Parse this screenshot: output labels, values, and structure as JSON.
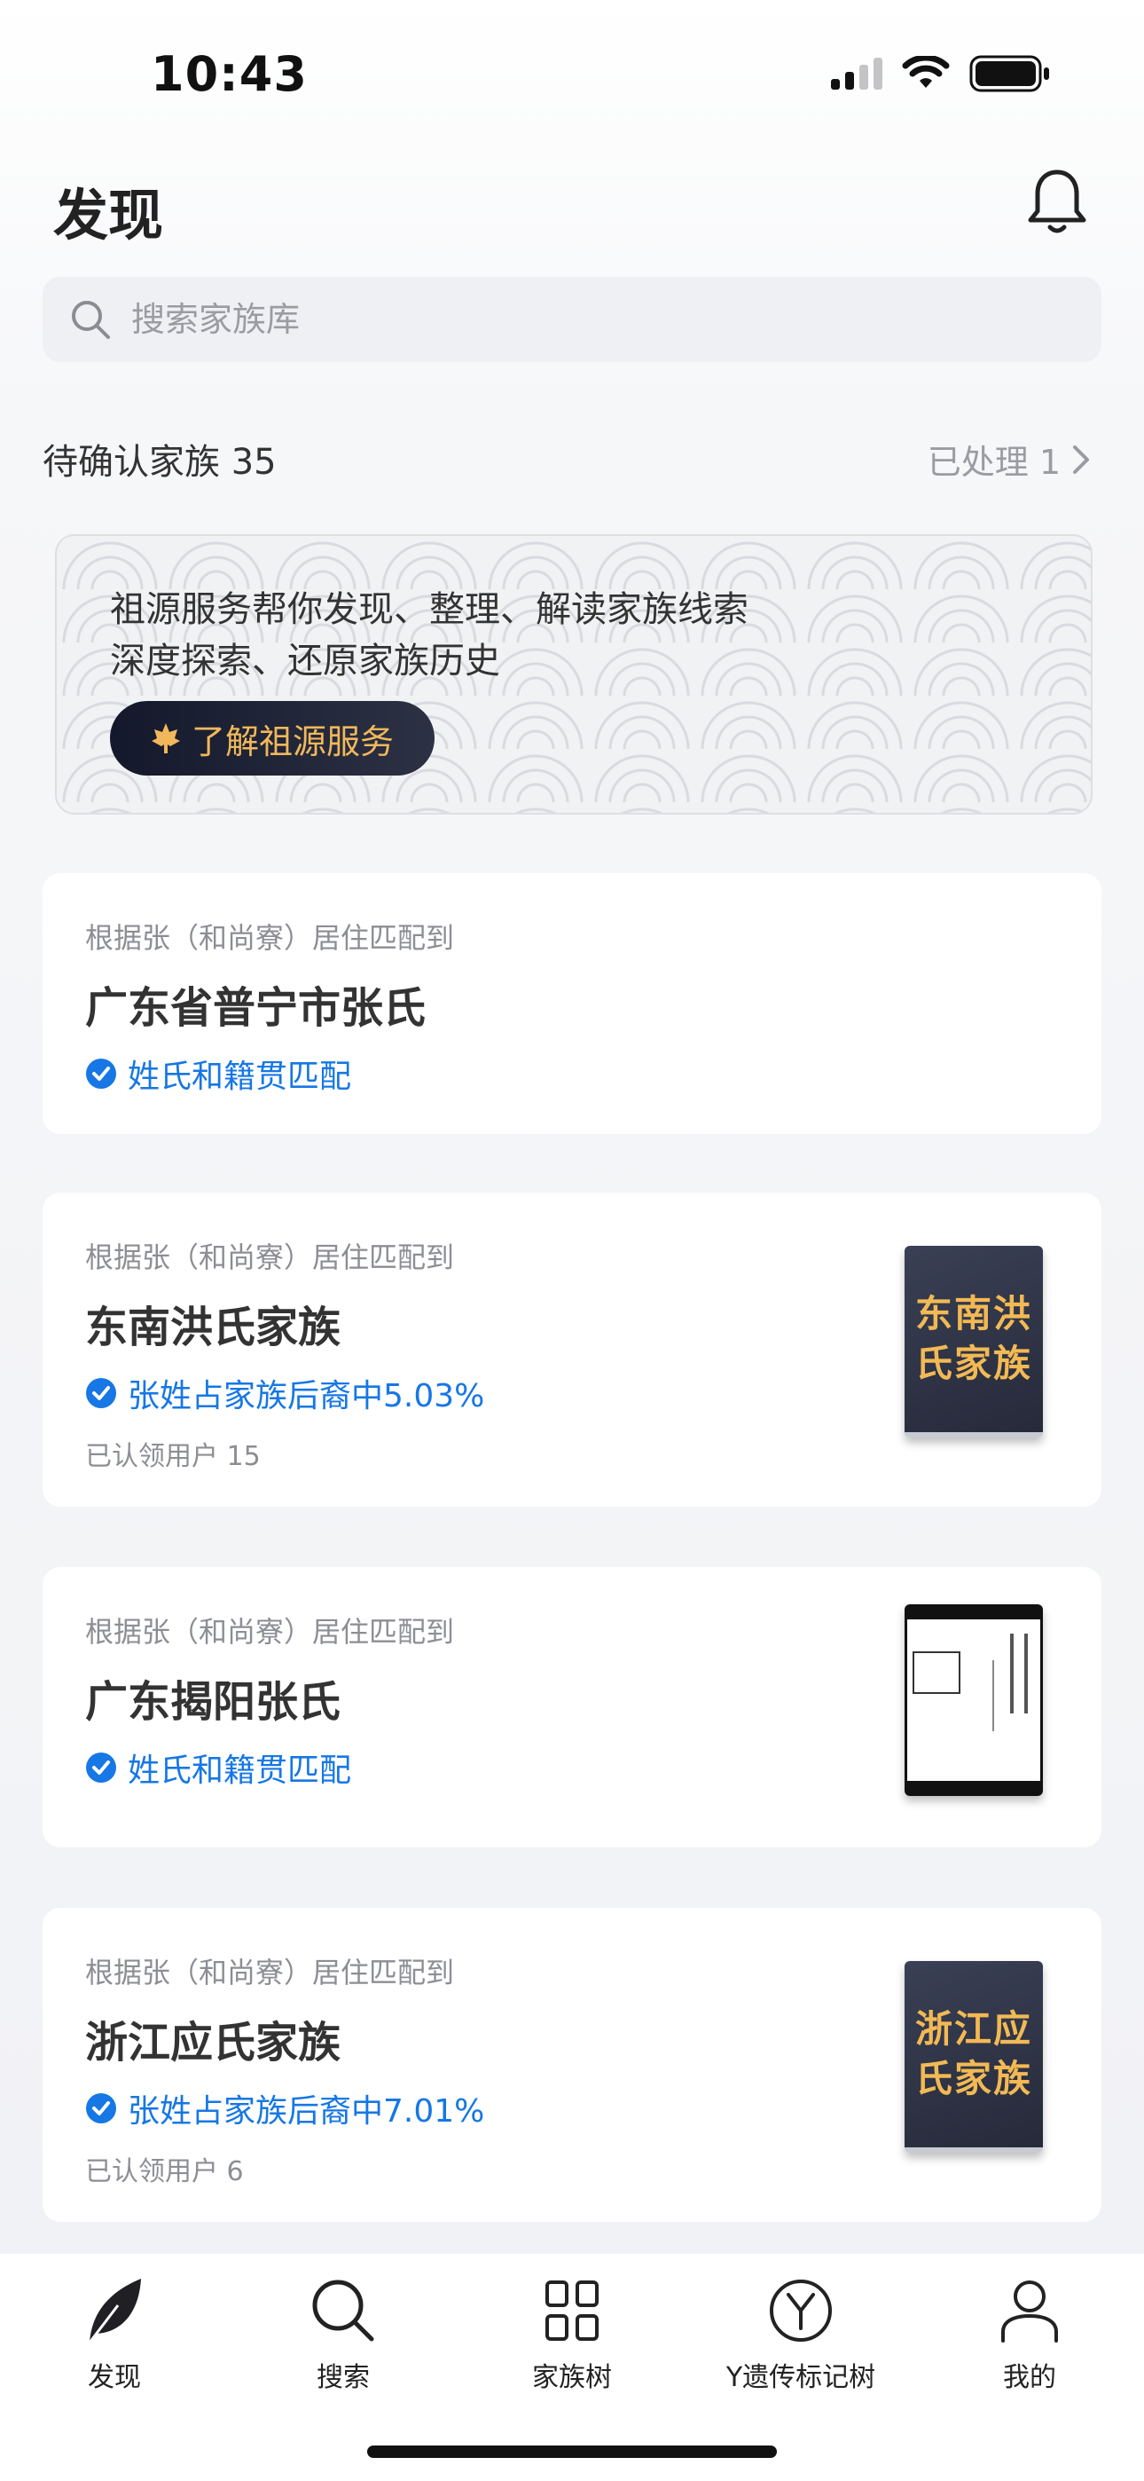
{
  "status_bar": {
    "time": "10:43"
  },
  "header": {
    "title": "发现"
  },
  "search": {
    "placeholder": "搜索家族库"
  },
  "pending": {
    "title": "待确认家族 35",
    "processed_label": "已处理 1"
  },
  "banner": {
    "line1": "祖源服务帮你发现、整理、解读家族线索",
    "line2": "深度探索、还原家族历史",
    "button_label": "了解祖源服务"
  },
  "cards": [
    {
      "source": "根据张（和尚寮）居住匹配到",
      "title": "广东省普宁市张氏",
      "tag": "姓氏和籍贯匹配"
    },
    {
      "source": "根据张（和尚寮）居住匹配到",
      "title": "东南洪氏家族",
      "tag": "张姓占家族后裔中5.03%",
      "users": "已认领用户 15",
      "book_title": "东南洪氏家族"
    },
    {
      "source": "根据张（和尚寮）居住匹配到",
      "title": "广东揭阳张氏",
      "tag": "姓氏和籍贯匹配"
    },
    {
      "source": "根据张（和尚寮）居住匹配到",
      "title": "浙江应氏家族",
      "tag": "张姓占家族后裔中7.01%",
      "users": "已认领用户 6",
      "book_title": "浙江应氏家族"
    }
  ],
  "tabbar": {
    "items": [
      {
        "label": "发现",
        "icon": "leaf-icon"
      },
      {
        "label": "搜索",
        "icon": "search-icon"
      },
      {
        "label": "家族树",
        "icon": "family-tree-icon"
      },
      {
        "label": "Y遗传标记树",
        "icon": "y-chromosome-icon"
      },
      {
        "label": "我的",
        "icon": "profile-icon"
      }
    ]
  },
  "colors": {
    "accent_blue": "#1677e5",
    "button_gold": "#f0b85a",
    "button_dark": "#14182b"
  }
}
